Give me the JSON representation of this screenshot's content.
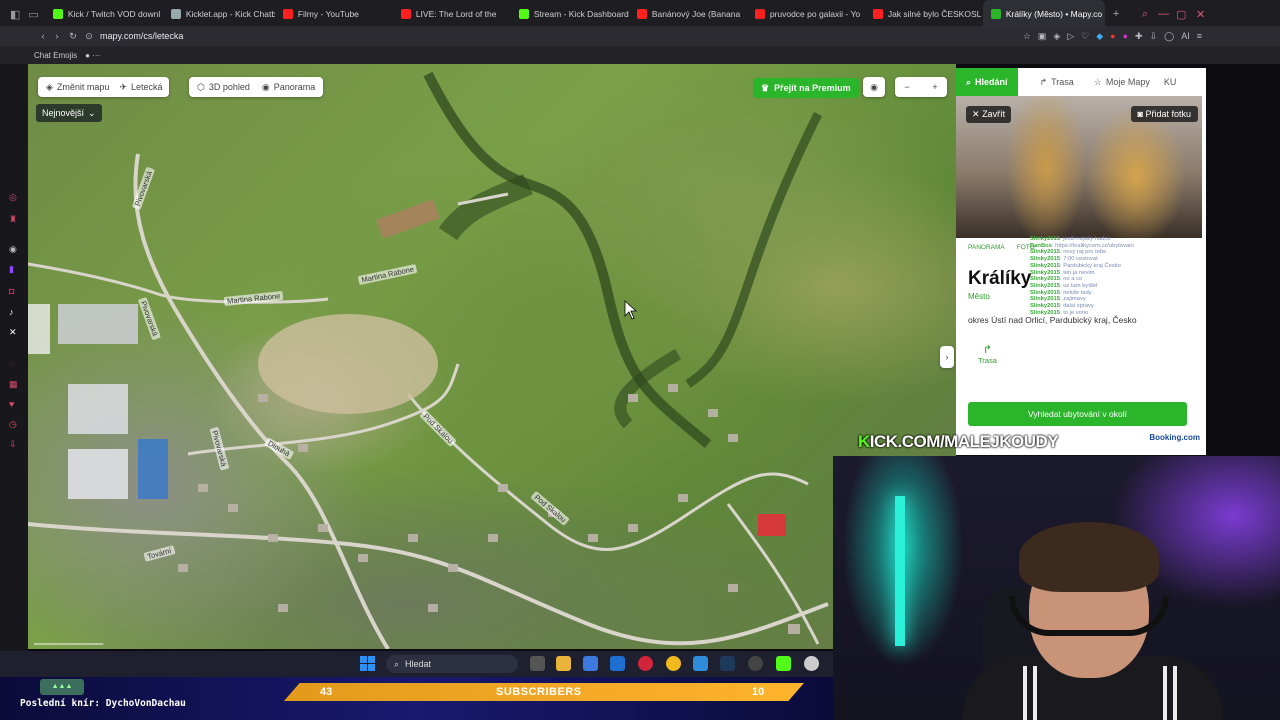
{
  "browser": {
    "tabs": [
      {
        "label": "Kick / Twitch VOD downl",
        "color": "#53fc18"
      },
      {
        "label": "Kicklet.app - Kick Chatb",
        "color": "#9aa"
      },
      {
        "label": "Filmy - YouTube",
        "color": "#ff2020"
      },
      {
        "label": "LIVE: The Lord of the",
        "color": "#ff2020"
      },
      {
        "label": "Stream - Kick Dashboard",
        "color": "#53fc18"
      },
      {
        "label": "Banánový Joe (Banana",
        "color": "#ff2020"
      },
      {
        "label": "pruvodce po galaxii - Yo",
        "color": "#ff2020"
      },
      {
        "label": "Jak silné bylo ČESKOSL",
        "color": "#ff2020"
      },
      {
        "label": "Králíky (Město) • Mapy.co",
        "color": "#2ab52a",
        "active": true
      }
    ],
    "url": "mapy.com/cs/letecka",
    "bookmark": "Chat Emojis"
  },
  "map": {
    "change_map_label": "Změnit mapu",
    "aerial_label": "Letecká",
    "view3d_label": "3D pohled",
    "panorama_label": "Panorama",
    "premium_label": "Přejít na Premium",
    "newest_label": "Nejnovější",
    "streets": [
      "Pivovarská",
      "Martina Rabone",
      "Martina Rabone",
      "Pivovarská",
      "Pod Skalou",
      "Dlouhá",
      "Pod Skalou",
      "Pivovarská",
      "Tovární"
    ]
  },
  "panel": {
    "tab_search": "Hledání",
    "tab_route": "Trasa",
    "tab_my_maps": "Moje Mapy",
    "user_initials": "KU",
    "close_label": "Zavřít",
    "add_photo_label": "Přidat fotku",
    "photo_tabs": [
      "PANORAMA",
      "FOTO"
    ],
    "title": "Králíky",
    "type": "Město",
    "description": "okres Ústí nad Orlicí, Pardubický kraj, Česko",
    "route_label": "Trasa",
    "accommodation_button": "Vyhledat ubytování v okolí",
    "booking_label": "Booking.com"
  },
  "chat_overlay": {
    "lines": [
      {
        "user": "Slinky2015",
        "msg": ": jestli nejaký hadce"
      },
      {
        "user": "BanBos",
        "msg": ": https://kralikycom.cz/ubytovani"
      },
      {
        "user": "Slinky2015",
        "msg": ": novy raj pro tebe"
      },
      {
        "user": "Slinky2015",
        "msg": ": 7:00 cestovat"
      },
      {
        "user": "Slinky2015",
        "msg": ": Pardubicky kraj Česko"
      },
      {
        "user": "Slinky2015",
        "msg": ": ten ja nevim"
      },
      {
        "user": "Slinky2015",
        "msg": ": no a co"
      },
      {
        "user": "Slinky2015",
        "msg": ": uz tam bydlel"
      },
      {
        "user": "Slinky2015",
        "msg": ": nekde tady"
      },
      {
        "user": "Slinky2015",
        "msg": ": zajimavy"
      },
      {
        "user": "Slinky2015",
        "msg": ": dalsi zpravy"
      },
      {
        "user": "Slinky2015",
        "msg": ": to je vono"
      }
    ]
  },
  "stream": {
    "kick_prefix": "K",
    "kick_url": "ICK.COM/MALEJKOUDY",
    "subs_current": "43",
    "subs_label": "SUBSCRIBERS",
    "subs_goal": "10",
    "last_emote": "Poslední knír: DychoVonDachau"
  },
  "taskbar": {
    "search_placeholder": "Hledat"
  }
}
